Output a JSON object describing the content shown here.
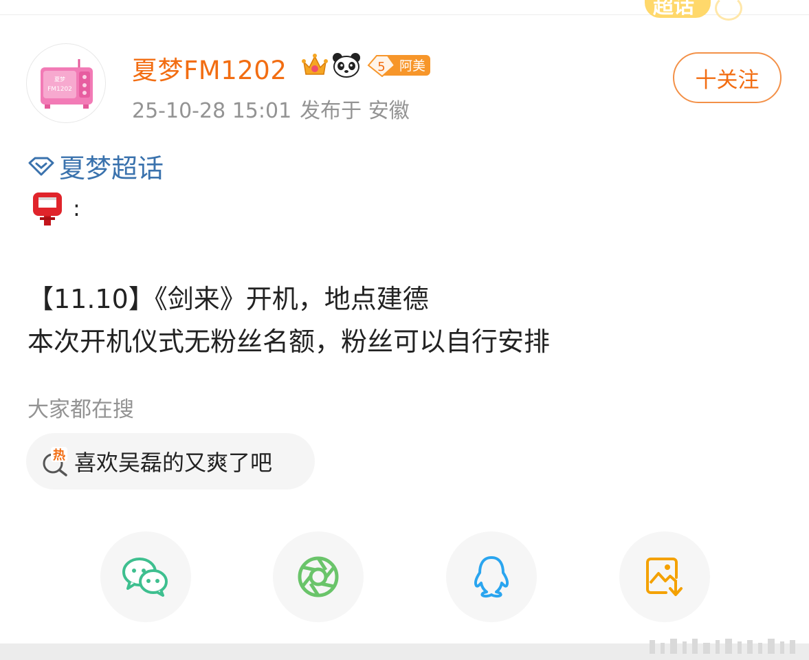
{
  "header": {
    "supertopic_badge_text": "超话"
  },
  "post": {
    "author": {
      "name": "夏梦FM1202",
      "avatar_text_top": "夏梦",
      "avatar_text_bottom": "FM1202",
      "badges": [
        "crown-icon",
        "panda-icon",
        "level-badge"
      ],
      "level": "5",
      "level_label": "阿美"
    },
    "timestamp": "25-10-28 15:01",
    "location": "发布于 安徽",
    "follow_label": "十关注",
    "topic": "夏梦超话",
    "emoji_colon": ":",
    "lines": [
      "【11.10】《剑来》开机，地点建德",
      "本次开机仪式无粉丝名额，粉丝可以自行安排"
    ]
  },
  "search": {
    "label": "大家都在搜",
    "chip_text": "喜欢吴磊的又爽了吧",
    "chip_icon_text": "热"
  },
  "share": {
    "buttons": [
      "wechat-icon",
      "moments-icon",
      "qq-icon",
      "save-image-icon"
    ]
  },
  "colors": {
    "accent_orange": "#f26d12",
    "topic_blue": "#3a72ad",
    "meta_gray": "#939393",
    "wechat_green": "#3ebf8f",
    "moments_green": "#6ac46a",
    "qq_blue": "#2aa5ef",
    "save_orange": "#f4a100"
  }
}
